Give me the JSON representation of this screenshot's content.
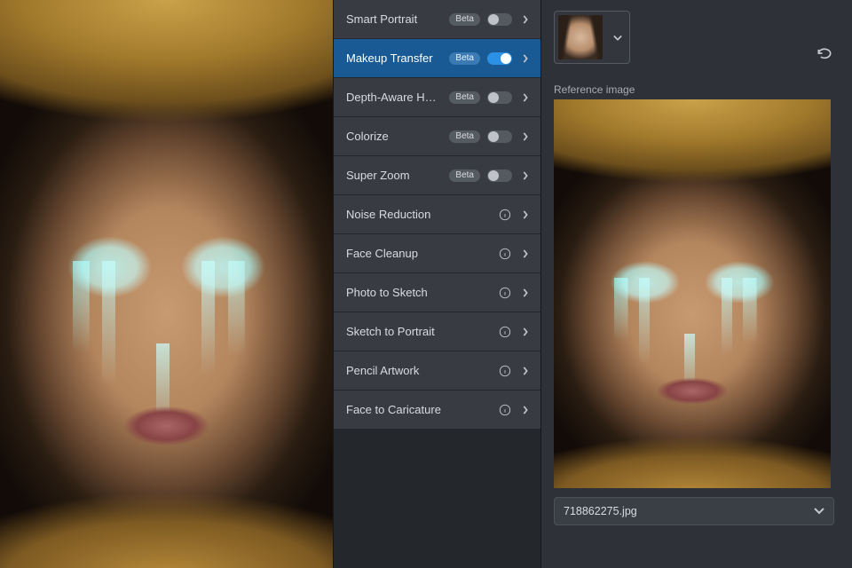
{
  "filters": {
    "items": [
      {
        "label": "Smart Portrait",
        "beta": "Beta",
        "toggle": false,
        "active": false
      },
      {
        "label": "Makeup Transfer",
        "beta": "Beta",
        "toggle": true,
        "active": true
      },
      {
        "label": "Depth-Aware H…",
        "beta": "Beta",
        "toggle": false,
        "active": false
      },
      {
        "label": "Colorize",
        "beta": "Beta",
        "toggle": false,
        "active": false
      },
      {
        "label": "Super Zoom",
        "beta": "Beta",
        "toggle": false,
        "active": false
      },
      {
        "label": "Noise Reduction",
        "info": true
      },
      {
        "label": "Face Cleanup",
        "info": true
      },
      {
        "label": "Photo to Sketch",
        "info": true
      },
      {
        "label": "Sketch to Portrait",
        "info": true
      },
      {
        "label": "Pencil Artwork",
        "info": true
      },
      {
        "label": "Face to Caricature",
        "info": true
      }
    ]
  },
  "side": {
    "reference_label": "Reference image",
    "file_name": "718862275.jpg"
  }
}
